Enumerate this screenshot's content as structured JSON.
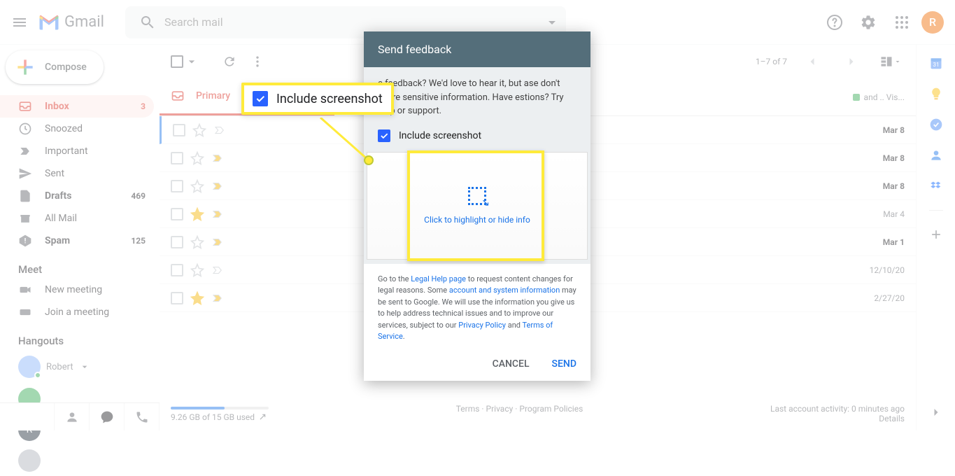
{
  "header": {
    "app_name": "Gmail",
    "search_placeholder": "Search mail",
    "avatar_initial": "R"
  },
  "sidebar": {
    "compose": "Compose",
    "items": [
      {
        "label": "Inbox",
        "count": "3"
      },
      {
        "label": "Snoozed",
        "count": ""
      },
      {
        "label": "Important",
        "count": ""
      },
      {
        "label": "Sent",
        "count": ""
      },
      {
        "label": "Drafts",
        "count": "469"
      },
      {
        "label": "All Mail",
        "count": ""
      },
      {
        "label": "Spam",
        "count": "125"
      }
    ],
    "meet_header": "Meet",
    "meet_items": [
      {
        "label": "New meeting"
      },
      {
        "label": "Join a meeting"
      }
    ],
    "hangouts_header": "Hangouts",
    "hangouts_user": "Robert"
  },
  "toolbar": {
    "pagination": "1–7 of 7"
  },
  "tabs": {
    "primary": "Primary"
  },
  "mail_rows": [
    {
      "date": "Mar 8",
      "bold": true,
      "star": false
    },
    {
      "date": "Mar 8",
      "bold": true,
      "star": false
    },
    {
      "date": "Mar 8",
      "bold": true,
      "star": false
    },
    {
      "date": "Mar 4",
      "bold": false,
      "star": true
    },
    {
      "date": "Mar 1",
      "bold": true,
      "star": false
    },
    {
      "date": "12/10/20",
      "bold": false,
      "star": false
    },
    {
      "date": "2/27/20",
      "bold": false,
      "star": true
    }
  ],
  "footer": {
    "storage": "9.26 GB of 15 GB used",
    "terms": "Terms",
    "privacy": "Privacy",
    "policies": "Program Policies",
    "activity": "Last account activity: 0 minutes ago",
    "details": "Details"
  },
  "dialog": {
    "title": "Send feedback",
    "body_suffix": "e feedback? We'd love to hear it, but ase don't share sensitive information. Have estions? Try help or support.",
    "include_screenshot": "Include screenshot",
    "click_hint": "Click to highlight or hide info",
    "legal_pre": "Go to the ",
    "legal_help_link": "Legal Help page",
    "legal_mid1": " to request content changes for legal reasons. Some ",
    "account_link": "account and system information",
    "legal_mid2": " may be sent to Google. We will use the information you give us to help address technical issues and to improve our services, subject to our ",
    "privacy_link": "Privacy Policy",
    "and": " and ",
    "tos_link": "Terms of Service",
    "period": ".",
    "cancel": "CANCEL",
    "send": "SEND"
  },
  "callout": {
    "label": "Include screenshot"
  },
  "snippet": {
    "and_vis": "and .. Vis..."
  }
}
